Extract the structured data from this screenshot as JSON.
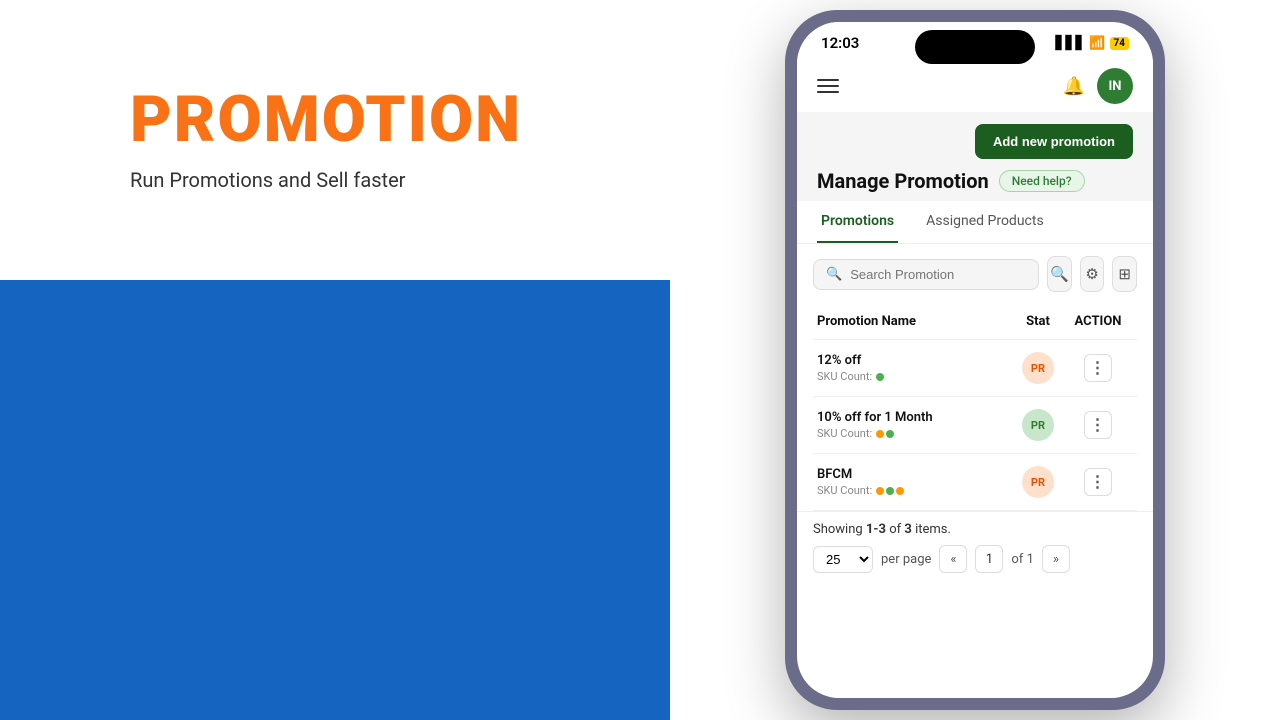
{
  "left": {
    "title": "PROMOTION",
    "subtitle": "Run Promotions and Sell faster",
    "colors": {
      "title": "#F97316",
      "bg_top": "#FFFFFF",
      "bg_bottom": "#1565C0"
    }
  },
  "phone": {
    "status_bar": {
      "time": "12:03",
      "battery": "74",
      "avatar_initials": "IN"
    },
    "header": {
      "add_button_label": "Add new promotion",
      "manage_title": "Manage Promotion",
      "need_help_label": "Need help?"
    },
    "tabs": [
      {
        "label": "Promotions",
        "active": true
      },
      {
        "label": "Assigned Products",
        "active": false
      }
    ],
    "search": {
      "placeholder": "Search Promotion"
    },
    "table": {
      "columns": {
        "name": "Promotion Name",
        "status": "Stat",
        "action": "ACTION"
      },
      "rows": [
        {
          "name": "12% off",
          "sku_label": "SKU Count:",
          "sku_count": 1,
          "status_badge": "PR",
          "status_color": "orange"
        },
        {
          "name": "10% off for 1 Month",
          "sku_label": "SKU Count:",
          "sku_count": 2,
          "status_badge": "PR",
          "status_color": "green"
        },
        {
          "name": "BFCM",
          "sku_label": "SKU Count:",
          "sku_count": 3,
          "status_badge": "PR",
          "status_color": "orange"
        }
      ]
    },
    "footer": {
      "showing_text": "Showing",
      "range": "1-3",
      "of_text": "of",
      "total": "3",
      "items_label": "items.",
      "per_page": "25",
      "page_current": "1",
      "page_total": "1"
    }
  }
}
